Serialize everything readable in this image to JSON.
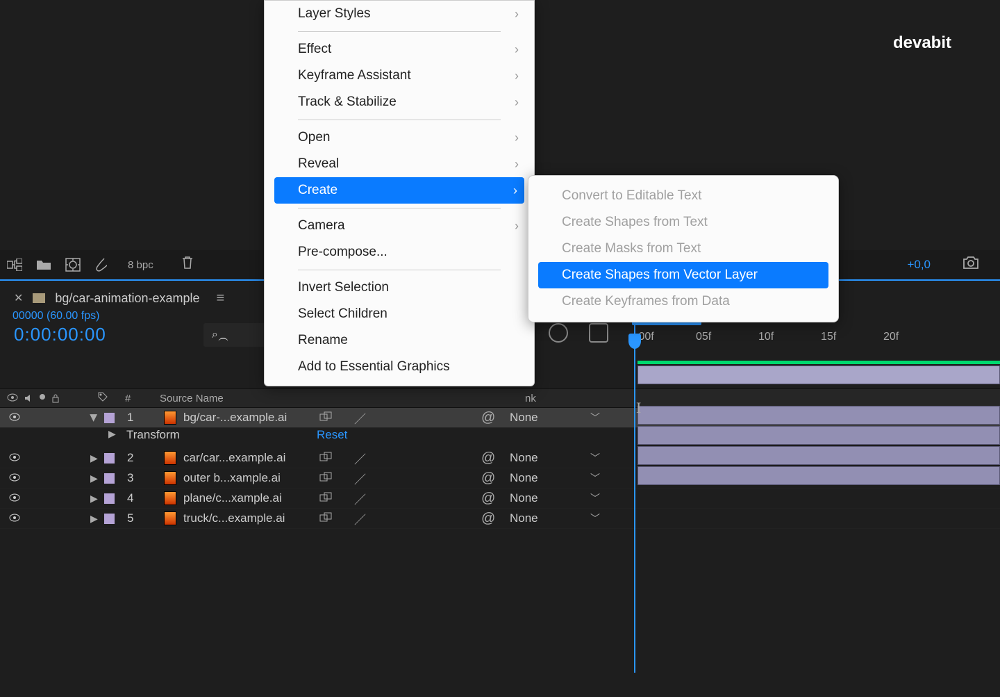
{
  "watermark": "devabit",
  "project_bar": {
    "bpc": "8 bpc",
    "coord": "+0,0"
  },
  "panel": {
    "tab_name": "bg/car-animation-example"
  },
  "timecode": {
    "value": "0:00:00:00",
    "fps": "00000 (60.00 fps)"
  },
  "columns": {
    "num": "#",
    "src": "Source Name",
    "link": "nk"
  },
  "transform": {
    "label": "Transform",
    "reset": "Reset"
  },
  "ticks": {
    "t00": ":00f",
    "t05": "05f",
    "t10": "10f",
    "t15": "15f",
    "t20": "20f"
  },
  "layers": [
    {
      "idx": "1",
      "name": "bg/car-...example.ai",
      "parent": "None",
      "selected": true
    },
    {
      "idx": "2",
      "name": "car/car...example.ai",
      "parent": "None",
      "selected": false
    },
    {
      "idx": "3",
      "name": "outer b...xample.ai",
      "parent": "None",
      "selected": false
    },
    {
      "idx": "4",
      "name": "plane/c...xample.ai",
      "parent": "None",
      "selected": false
    },
    {
      "idx": "5",
      "name": "truck/c...example.ai",
      "parent": "None",
      "selected": false
    }
  ],
  "context_menu": [
    {
      "label": "Layer Styles",
      "submenu": true
    },
    {
      "sep": true
    },
    {
      "label": "Effect",
      "submenu": true
    },
    {
      "label": "Keyframe Assistant",
      "submenu": true
    },
    {
      "label": "Track & Stabilize",
      "submenu": true
    },
    {
      "sep": true
    },
    {
      "label": "Open",
      "submenu": true
    },
    {
      "label": "Reveal",
      "submenu": true
    },
    {
      "label": "Create",
      "submenu": true,
      "highlighted": true
    },
    {
      "sep": true
    },
    {
      "label": "Camera",
      "submenu": true
    },
    {
      "label": "Pre-compose..."
    },
    {
      "sep": true
    },
    {
      "label": "Invert Selection"
    },
    {
      "label": "Select Children"
    },
    {
      "label": "Rename"
    },
    {
      "label": "Add to Essential Graphics"
    }
  ],
  "submenu": [
    {
      "label": "Convert to Editable Text",
      "enabled": false
    },
    {
      "label": "Create Shapes from Text",
      "enabled": false
    },
    {
      "label": "Create Masks from Text",
      "enabled": false
    },
    {
      "label": "Create Shapes from Vector Layer",
      "enabled": true,
      "highlighted": true
    },
    {
      "label": "Create Keyframes from Data",
      "enabled": false
    }
  ]
}
